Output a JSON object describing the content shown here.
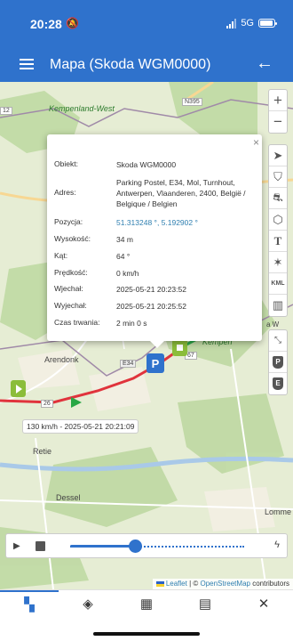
{
  "status_bar": {
    "time": "20:28",
    "network": "5G",
    "battery_level": 0.9
  },
  "app_bar": {
    "title": "Mapa (Skoda WGM0000)"
  },
  "map": {
    "places": [
      "Kempenland-West",
      "Arendonk",
      "Retie",
      "Dessel",
      "Lomme",
      "Kempen",
      "a W"
    ],
    "roads": [
      "N395",
      "12",
      "E34",
      "67",
      "26"
    ]
  },
  "popup": {
    "rows": [
      {
        "label": "Obiekt:",
        "value": "Skoda WGM0000"
      },
      {
        "label": "Adres:",
        "value": "Parking Postel, E34, Mol, Turnhout, Antwerpen, Vlaanderen, 2400, België / Belgique / Belgien"
      },
      {
        "label": "Pozycja:",
        "value": "51.313248 °, 5.192902 °"
      },
      {
        "label": "Wysokość:",
        "value": "34 m"
      },
      {
        "label": "Kąt:",
        "value": "64 °"
      },
      {
        "label": "Prędkość:",
        "value": "0 km/h"
      },
      {
        "label": "Wjechał:",
        "value": "2025-05-21 20:23:52"
      },
      {
        "label": "Wyjechał:",
        "value": "2025-05-21 20:25:52"
      },
      {
        "label": "Czas trwania:",
        "value": "2 min 0 s"
      }
    ]
  },
  "track_tooltip": "130 km/h - 2025-05-21 20:21:09",
  "marker_label": "P",
  "map_controls": {
    "zoom_in": "+",
    "zoom_out": "−",
    "kml": "KML"
  },
  "playback": {
    "progress": 0.37
  },
  "attribution": {
    "leaflet": "Leaflet",
    "sep": " | © ",
    "osm": "OpenStreetMap",
    "rest": " contributors"
  },
  "colors": {
    "primary": "#2f72cc",
    "track": "#e0333c",
    "map_bg": "#e6edd4",
    "forest": "#bfd9a3"
  }
}
